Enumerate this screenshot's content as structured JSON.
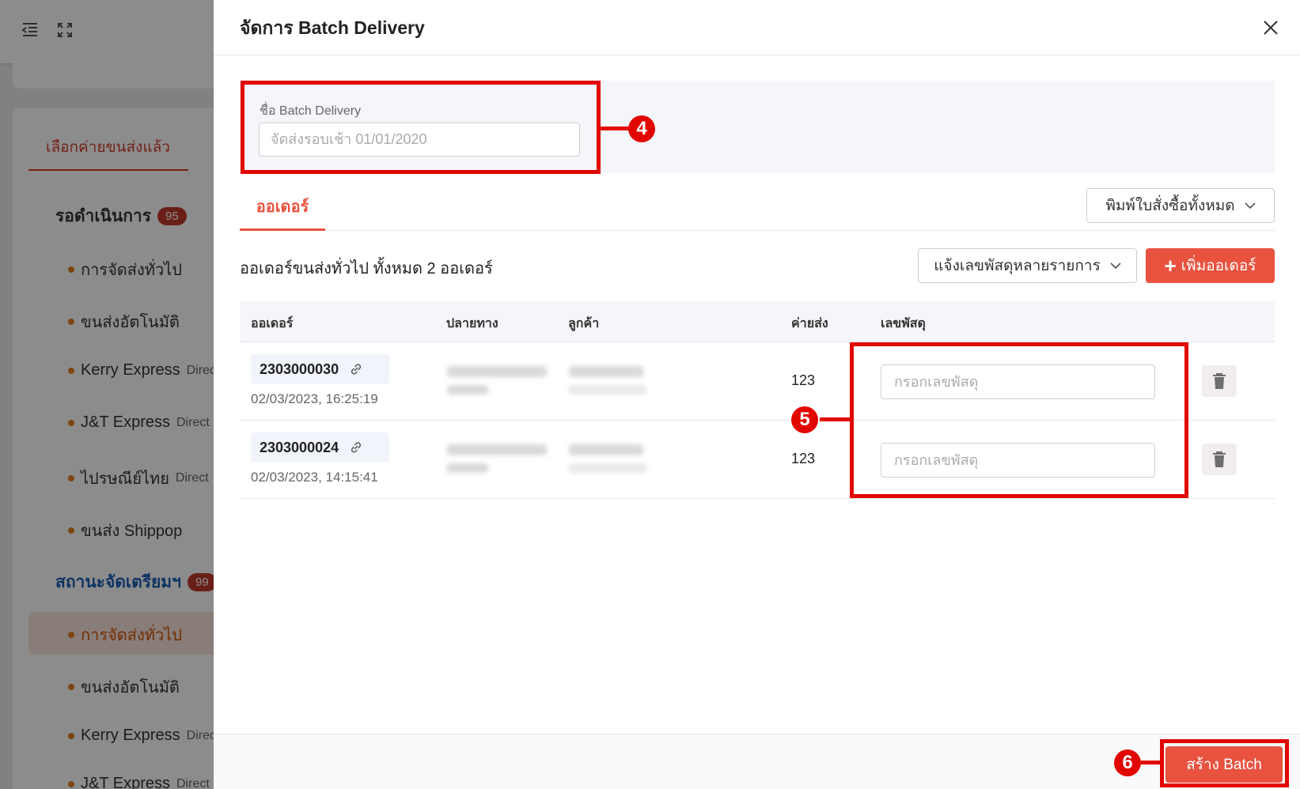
{
  "background": {
    "tab_label": "เลือกค่ายขนส่งแล้ว",
    "section_pending": {
      "label": "รอดำเนินการ",
      "count": "95"
    },
    "pending_items": [
      {
        "label": "การจัดส่งทั่วไป",
        "suffix": ""
      },
      {
        "label": "ขนส่งอัตโนมัติ",
        "suffix": ""
      },
      {
        "label": "Kerry Express",
        "suffix": "Direct"
      },
      {
        "label": "J&T Express",
        "suffix": "Direct"
      },
      {
        "label": "ไปรษณีย์ไทย",
        "suffix": "Direct"
      },
      {
        "label": "ขนส่ง Shippop",
        "suffix": ""
      }
    ],
    "section_prepare": {
      "label": "สถานะจัดเตรียมฯ",
      "count": "99"
    },
    "prepare_items": [
      {
        "label": "การจัดส่งทั่วไป",
        "suffix": ""
      },
      {
        "label": "ขนส่งอัตโนมัติ",
        "suffix": ""
      },
      {
        "label": "Kerry Express",
        "suffix": "Direct"
      },
      {
        "label": "J&T Express",
        "suffix": "Direct"
      }
    ]
  },
  "drawer": {
    "title": "จัดการ Batch Delivery",
    "name_label": "ชื่อ Batch Delivery",
    "name_placeholder": "จัดส่งรอบเช้า 01/01/2020",
    "tab_orders": "ออเดอร์",
    "print_all_label": "พิมพ์ใบสั่งซื้อทั้งหมด",
    "summary": "ออเดอร์ขนส่งทั่วไป ทั้งหมด 2 ออเดอร์",
    "notify_tracking_label": "แจ้งเลขพัสดุหลายรายการ",
    "add_order_label": "เพิ่มออเดอร์",
    "columns": {
      "order": "ออเดอร์",
      "destination": "ปลายทาง",
      "customer": "ลูกค้า",
      "shipping_cost": "ค่ายส่ง",
      "tracking": "เลขพัสดุ"
    },
    "orders": [
      {
        "id": "2303000030",
        "date": "02/03/2023, 16:25:19",
        "shipping_cost": "123",
        "tracking_placeholder": "กรอกเลขพัสดุ"
      },
      {
        "id": "2303000024",
        "date": "02/03/2023, 14:15:41",
        "shipping_cost": "123",
        "tracking_placeholder": "กรอกเลขพัสดุ"
      }
    ],
    "create_batch_label": "สร้าง Batch"
  },
  "annotations": [
    "4",
    "5",
    "6"
  ],
  "colors": {
    "accent": "#e8523f",
    "annotation_red": "#e10600",
    "badge_red": "#c0392b",
    "link_blue": "#1a5fb4"
  }
}
